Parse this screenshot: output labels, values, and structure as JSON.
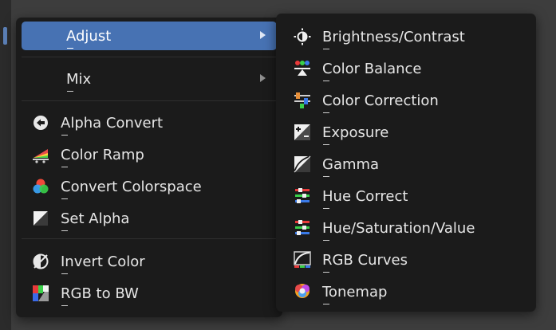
{
  "main_menu": {
    "items": [
      {
        "label": "Adjust",
        "icon": "none",
        "has_submenu": true,
        "highlighted": true
      },
      {
        "label": "Mix",
        "icon": "none",
        "has_submenu": true,
        "highlighted": false
      },
      {
        "label": "Alpha Convert",
        "icon": "alpha-convert-icon"
      },
      {
        "label": "Color Ramp",
        "icon": "color-ramp-icon"
      },
      {
        "label": "Convert Colorspace",
        "icon": "convert-colorspace-icon"
      },
      {
        "label": "Set Alpha",
        "icon": "set-alpha-icon"
      },
      {
        "label": "Invert Color",
        "icon": "invert-color-icon"
      },
      {
        "label": "RGB to BW",
        "icon": "rgb-to-bw-icon"
      }
    ]
  },
  "sub_menu": {
    "items": [
      {
        "label": "Brightness/Contrast",
        "icon": "brightness-contrast-icon"
      },
      {
        "label": "Color Balance",
        "icon": "color-balance-icon"
      },
      {
        "label": "Color Correction",
        "icon": "color-correction-icon"
      },
      {
        "label": "Exposure",
        "icon": "exposure-icon"
      },
      {
        "label": "Gamma",
        "icon": "gamma-icon"
      },
      {
        "label": "Hue Correct",
        "icon": "hue-correct-icon"
      },
      {
        "label": "Hue/Saturation/Value",
        "icon": "hue-saturation-value-icon"
      },
      {
        "label": "RGB Curves",
        "icon": "rgb-curves-icon"
      },
      {
        "label": "Tonemap",
        "icon": "tonemap-icon"
      }
    ]
  },
  "colors": {
    "menu_bg": "#1b1b1b",
    "highlight": "#4772b3",
    "text": "#e6e6e6",
    "separator": "#2f2f2f"
  }
}
